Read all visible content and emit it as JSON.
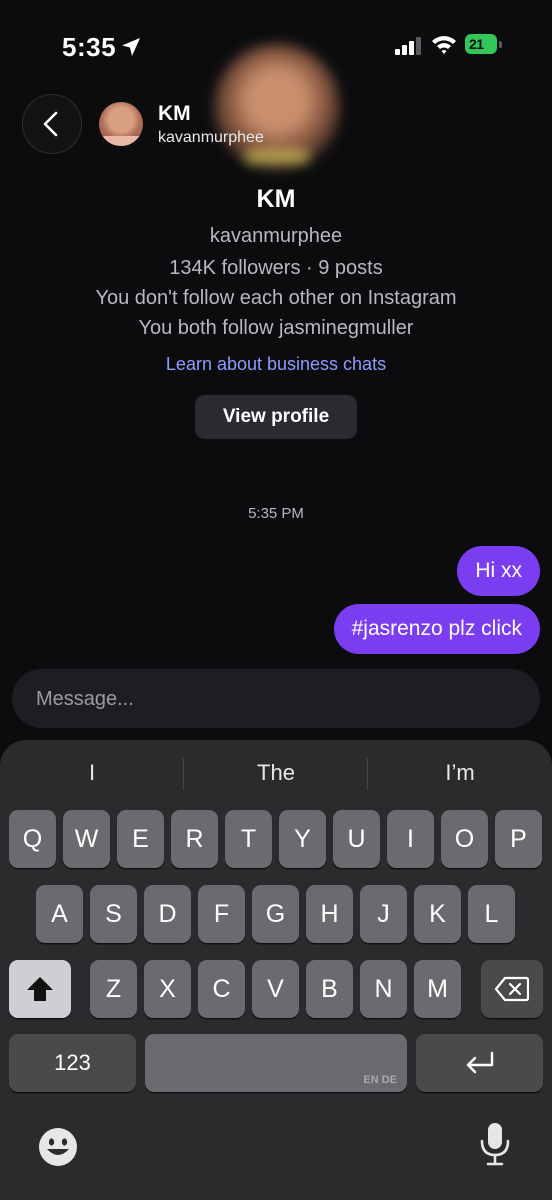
{
  "status_bar": {
    "time": "5:35",
    "battery": "21"
  },
  "header": {
    "name": "KM",
    "username": "kavanmurphee"
  },
  "profile": {
    "name": "KM",
    "username": "kavanmurphee",
    "stats": "134K followers · 9 posts",
    "mutual_follow": "You don't follow each other on Instagram",
    "mutual_friend": "You both follow jasminegmuller",
    "business_link": "Learn about business chats",
    "view_profile_label": "View profile"
  },
  "chat": {
    "timestamp": "5:35 PM",
    "messages": [
      {
        "text": "Hi xx",
        "sender": "me"
      },
      {
        "text": "#jasrenzo plz click",
        "sender": "me"
      }
    ]
  },
  "composer": {
    "placeholder": "Message..."
  },
  "keyboard": {
    "suggestions": [
      "I",
      "The",
      "I’m"
    ],
    "row1": [
      "Q",
      "W",
      "E",
      "R",
      "T",
      "Y",
      "U",
      "I",
      "O",
      "P"
    ],
    "row2": [
      "A",
      "S",
      "D",
      "F",
      "G",
      "H",
      "J",
      "K",
      "L"
    ],
    "row3": [
      "Z",
      "X",
      "C",
      "V",
      "B",
      "N",
      "M"
    ],
    "numbers_label": "123",
    "space_languages": "EN DE"
  },
  "colors": {
    "accent_bubble": "#7b3df0",
    "link": "#8c9cff",
    "battery": "#33c759",
    "background": "#0c0c0e"
  },
  "icons": [
    "location-arrow-icon",
    "signal-icon",
    "wifi-icon",
    "battery-icon",
    "back-chevron-icon",
    "shift-icon",
    "backspace-icon",
    "return-icon",
    "emoji-icon",
    "microphone-icon"
  ]
}
